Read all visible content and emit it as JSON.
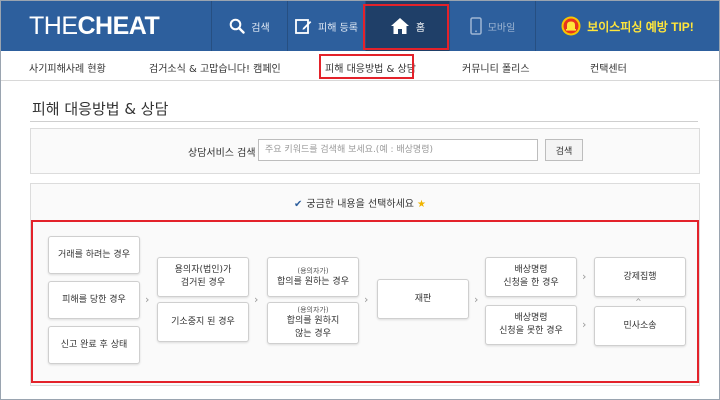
{
  "header": {
    "logo_part1": "THE",
    "logo_part2": "CHEAT",
    "nav": {
      "search": "검색",
      "report": "피해 등록",
      "home": "홈",
      "mobile": "모바일",
      "tip": "보이스피싱 예방 TIP!"
    }
  },
  "subnav": [
    "사기피해사례 현황",
    "검거소식 & 고맙습니다! 캠페인",
    "피해 대응방법 & 상담",
    "커뮤니티 폴리스",
    "컨택센터"
  ],
  "page_title": "피해 대응방법 & 상담",
  "search": {
    "label": "상담서비스 검색",
    "placeholder": "주요 키워드를 검색해 보세요.(예 : 배상명령)",
    "button": "검색"
  },
  "guide": {
    "prompt": "궁금한 내용을 선택하세요"
  },
  "steps": {
    "c1": [
      "거래를 하려는 경우",
      "피해를 당한 경우",
      "신고 완료 후 상태"
    ],
    "c2": [
      [
        "용의자(법인)가",
        "검거된 경우"
      ],
      [
        "기소중지 된 경우"
      ]
    ],
    "c3": [
      {
        "small": "(용의자가)",
        "lines": [
          "합의를 원하는 경우"
        ]
      },
      {
        "small": "(용의자가)",
        "lines": [
          "합의를 원하지",
          "않는 경우"
        ]
      }
    ],
    "c4": "재판",
    "c5": [
      [
        "배상명령",
        "신청을 한 경우"
      ],
      [
        "배상명령",
        "신청을 못한 경우"
      ]
    ],
    "c6": [
      "강제집행",
      "민사소송"
    ]
  },
  "colors": {
    "header_bg": "#2d5f9d",
    "highlight_red": "#e3222a",
    "tip_yellow": "#ffe53b"
  }
}
